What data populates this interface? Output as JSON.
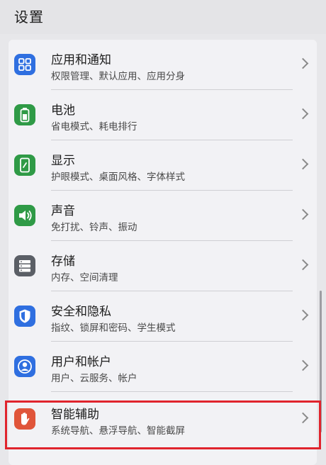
{
  "header": {
    "title": "设置"
  },
  "items": [
    {
      "title": "应用和通知",
      "subtitle": "权限管理、默认应用、应用分身",
      "icon": "apps-icon",
      "color": "#2f6fe0"
    },
    {
      "title": "电池",
      "subtitle": "省电模式、耗电排行",
      "icon": "battery-icon",
      "color": "#2f9a46"
    },
    {
      "title": "显示",
      "subtitle": "护眼模式、桌面风格、字体样式",
      "icon": "display-icon",
      "color": "#2f9a46"
    },
    {
      "title": "声音",
      "subtitle": "免打扰、铃声、振动",
      "icon": "speaker-icon",
      "color": "#2f9a46"
    },
    {
      "title": "存储",
      "subtitle": "内存、空间清理",
      "icon": "storage-icon",
      "color": "#5b5f66"
    },
    {
      "title": "安全和隐私",
      "subtitle": "指纹、锁屏和密码、学生模式",
      "icon": "shield-icon",
      "color": "#2f6fe0"
    },
    {
      "title": "用户和帐户",
      "subtitle": "用户、云服务、帐户",
      "icon": "user-icon",
      "color": "#2f6fe0"
    },
    {
      "title": "智能辅助",
      "subtitle": "系统导航、悬浮导航、智能截屏",
      "icon": "hand-icon",
      "color": "#e0553a"
    }
  ],
  "highlight_color": "#e0242d"
}
